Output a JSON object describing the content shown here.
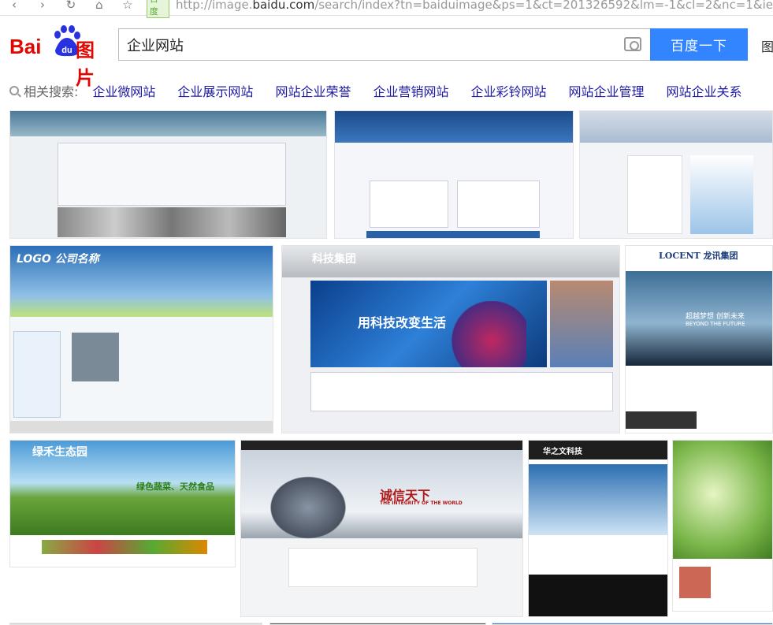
{
  "browser": {
    "url_badge": "百度",
    "url_prefix": "http://image.",
    "url_domain": "baidu.com",
    "url_rest": "/search/index?tn=baiduimage&ps=1&ct=201326592&lm=-1&cl=2&nc=1&ie"
  },
  "logo": {
    "bai": "Bai",
    "du": "du",
    "pic": "图片"
  },
  "search": {
    "value": "企业网站",
    "button": "百度一下",
    "more": "图"
  },
  "related": {
    "label": "相关搜索:",
    "items": [
      "企业微网站",
      "企业展示网站",
      "网站企业荣誉",
      "企业营销网站",
      "企业彩铃网站",
      "网站企业管理",
      "网站企业关系"
    ]
  },
  "thumbnails": [
    {
      "caption": ""
    },
    {
      "caption": ""
    },
    {
      "caption": ""
    },
    {
      "caption": "LOGO 公司名称"
    },
    {
      "caption": "科技集团",
      "caption2": "用科技改变生活"
    },
    {
      "caption": "LOCENT 龙讯集团",
      "caption2": "超越梦想 创新未来",
      "caption3": "BEYOND THE FUTURE"
    },
    {
      "caption": "绿禾生态园",
      "caption2": "绿色蔬菜、天然食品"
    },
    {
      "caption": "诚信天下",
      "caption2": "THE INTEGRITY OF THE WORLD"
    },
    {
      "caption": "华之文科技"
    },
    {
      "caption": ""
    }
  ]
}
